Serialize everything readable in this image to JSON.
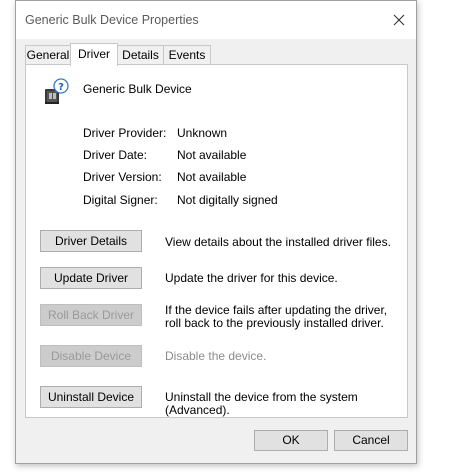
{
  "window": {
    "title": "Generic Bulk Device Properties"
  },
  "tabs": [
    {
      "label": "General"
    },
    {
      "label": "Driver",
      "active": true
    },
    {
      "label": "Details"
    },
    {
      "label": "Events"
    }
  ],
  "device": {
    "name": "Generic Bulk Device",
    "icon": "usb-device-help-icon"
  },
  "properties": [
    {
      "label": "Driver Provider:",
      "value": "Unknown"
    },
    {
      "label": "Driver Date:",
      "value": "Not available"
    },
    {
      "label": "Driver Version:",
      "value": "Not available"
    },
    {
      "label": "Digital Signer:",
      "value": "Not digitally signed"
    }
  ],
  "actions": [
    {
      "label": "Driver Details",
      "description": "View details about the installed driver files.",
      "enabled": true
    },
    {
      "label": "Update Driver",
      "description": "Update the driver for this device.",
      "enabled": true
    },
    {
      "label": "Roll Back Driver",
      "description": "If the device fails after updating the driver, roll back to the previously installed driver.",
      "enabled": false
    },
    {
      "label": "Disable Device",
      "description": "Disable the device.",
      "enabled": false
    },
    {
      "label": "Uninstall Device",
      "description": "Uninstall the device from the system (Advanced).",
      "enabled": true
    }
  ],
  "footer": {
    "ok_label": "OK",
    "cancel_label": "Cancel"
  },
  "colors": {
    "window_bg": "#f0f0f0",
    "panel_bg": "#ffffff",
    "disabled_text": "#9a9a9a"
  }
}
